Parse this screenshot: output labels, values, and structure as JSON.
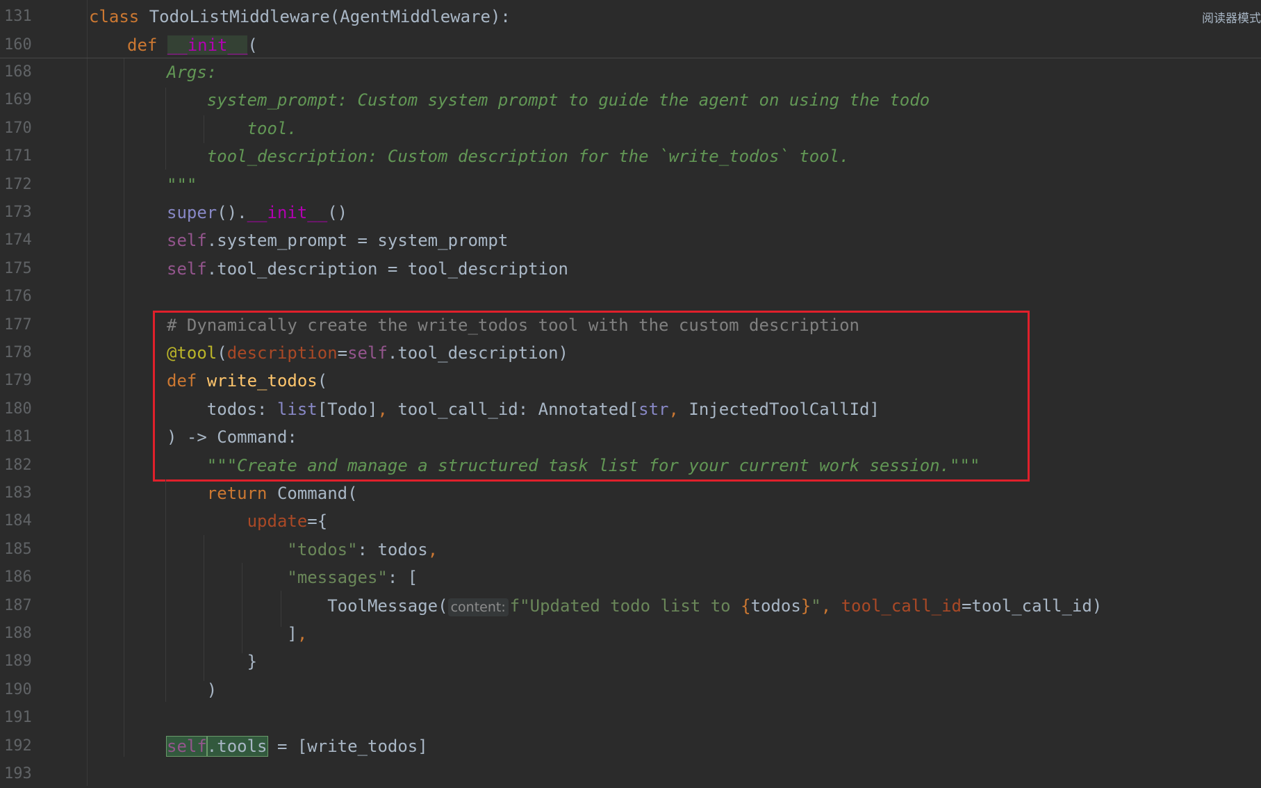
{
  "header": {
    "reader_mode_label": "阅读器模式"
  },
  "sticky": [
    {
      "ln": "131",
      "tokens": [
        {
          "c": "kw",
          "t": "class "
        },
        {
          "c": "plain",
          "t": "TodoListMiddleware(AgentMiddleware):"
        }
      ]
    },
    {
      "ln": "160",
      "tokens": [
        {
          "c": "kw",
          "t": "def "
        },
        {
          "c": "dunder hl-green",
          "t": "__init__"
        },
        {
          "c": "plain",
          "t": "("
        }
      ]
    }
  ],
  "lines": [
    {
      "ln": "168",
      "tokens": [
        {
          "c": "doc",
          "t": "Args:"
        }
      ]
    },
    {
      "ln": "169",
      "tokens": [
        {
          "c": "doc",
          "t": "    system_prompt: Custom system prompt to guide the agent on using the todo"
        }
      ]
    },
    {
      "ln": "170",
      "tokens": [
        {
          "c": "doc",
          "t": "        tool."
        }
      ]
    },
    {
      "ln": "171",
      "tokens": [
        {
          "c": "doc",
          "t": "    tool_description: Custom description for the `write_todos` tool."
        }
      ]
    },
    {
      "ln": "172",
      "tokens": [
        {
          "c": "doc",
          "t": "\"\"\""
        }
      ]
    },
    {
      "ln": "173",
      "tokens": [
        {
          "c": "bi",
          "t": "super"
        },
        {
          "c": "plain",
          "t": "()."
        },
        {
          "c": "dunder",
          "t": "__init__"
        },
        {
          "c": "plain",
          "t": "()"
        }
      ]
    },
    {
      "ln": "174",
      "tokens": [
        {
          "c": "self",
          "t": "self"
        },
        {
          "c": "plain",
          "t": ".system_prompt = system_prompt"
        }
      ]
    },
    {
      "ln": "175",
      "tokens": [
        {
          "c": "self",
          "t": "self"
        },
        {
          "c": "plain",
          "t": ".tool_description = tool_description"
        }
      ]
    },
    {
      "ln": "176",
      "tokens": []
    },
    {
      "ln": "177",
      "tokens": [
        {
          "c": "cmt",
          "t": "# Dynamically create the write_todos tool with the custom description"
        }
      ]
    },
    {
      "ln": "178",
      "tokens": [
        {
          "c": "deco",
          "t": "@tool"
        },
        {
          "c": "plain",
          "t": "("
        },
        {
          "c": "param",
          "t": "description"
        },
        {
          "c": "plain",
          "t": "="
        },
        {
          "c": "self",
          "t": "self"
        },
        {
          "c": "plain",
          "t": ".tool_description)"
        }
      ]
    },
    {
      "ln": "179",
      "tokens": [
        {
          "c": "kw",
          "t": "def "
        },
        {
          "c": "fn",
          "t": "write_todos"
        },
        {
          "c": "plain",
          "t": "("
        }
      ]
    },
    {
      "ln": "180",
      "tokens": [
        {
          "c": "plain",
          "t": "    todos: "
        },
        {
          "c": "bi",
          "t": "list"
        },
        {
          "c": "plain",
          "t": "[Todo]"
        },
        {
          "c": "kw",
          "t": ", "
        },
        {
          "c": "plain",
          "t": "tool_call_id: Annotated["
        },
        {
          "c": "bi",
          "t": "str"
        },
        {
          "c": "kw",
          "t": ", "
        },
        {
          "c": "plain",
          "t": "InjectedToolCallId]"
        }
      ]
    },
    {
      "ln": "181",
      "tokens": [
        {
          "c": "plain",
          "t": ") -> Command:"
        }
      ]
    },
    {
      "ln": "182",
      "tokens": [
        {
          "c": "doc",
          "t": "    \"\"\"Create and manage a structured task list for your current work session.\"\"\""
        }
      ]
    },
    {
      "ln": "183",
      "tokens": [
        {
          "c": "kw",
          "t": "    return "
        },
        {
          "c": "plain",
          "t": "Command("
        }
      ]
    },
    {
      "ln": "184",
      "tokens": [
        {
          "c": "param",
          "t": "        update"
        },
        {
          "c": "plain",
          "t": "={"
        }
      ]
    },
    {
      "ln": "185",
      "tokens": [
        {
          "c": "str",
          "t": "            \"todos\""
        },
        {
          "c": "plain",
          "t": ": todos"
        },
        {
          "c": "kw",
          "t": ","
        }
      ]
    },
    {
      "ln": "186",
      "tokens": [
        {
          "c": "str",
          "t": "            \"messages\""
        },
        {
          "c": "plain",
          "t": ": ["
        }
      ]
    },
    {
      "ln": "187",
      "tokens": [
        {
          "c": "plain",
          "t": "                ToolMessage("
        },
        {
          "c": "hint",
          "t": "content:"
        },
        {
          "c": "str",
          "t": "f\"Updated todo list to "
        },
        {
          "c": "kw",
          "t": "{"
        },
        {
          "c": "plain",
          "t": "todos"
        },
        {
          "c": "kw",
          "t": "}"
        },
        {
          "c": "str",
          "t": "\""
        },
        {
          "c": "kw",
          "t": ", "
        },
        {
          "c": "param",
          "t": "tool_call_id"
        },
        {
          "c": "plain",
          "t": "=tool_call_id)"
        }
      ]
    },
    {
      "ln": "188",
      "tokens": [
        {
          "c": "plain",
          "t": "            ]"
        },
        {
          "c": "kw",
          "t": ","
        }
      ]
    },
    {
      "ln": "189",
      "tokens": [
        {
          "c": "plain",
          "t": "        }"
        }
      ]
    },
    {
      "ln": "190",
      "tokens": [
        {
          "c": "plain",
          "t": "    )"
        }
      ]
    },
    {
      "ln": "191",
      "tokens": []
    },
    {
      "ln": "192",
      "tokens": [
        {
          "c": "self hl-box",
          "t": "self"
        },
        {
          "c": "plain hl-box",
          "t": ".tools"
        },
        {
          "c": "plain",
          "t": " = [write_todos]"
        }
      ]
    },
    {
      "ln": "193",
      "tokens": []
    }
  ]
}
